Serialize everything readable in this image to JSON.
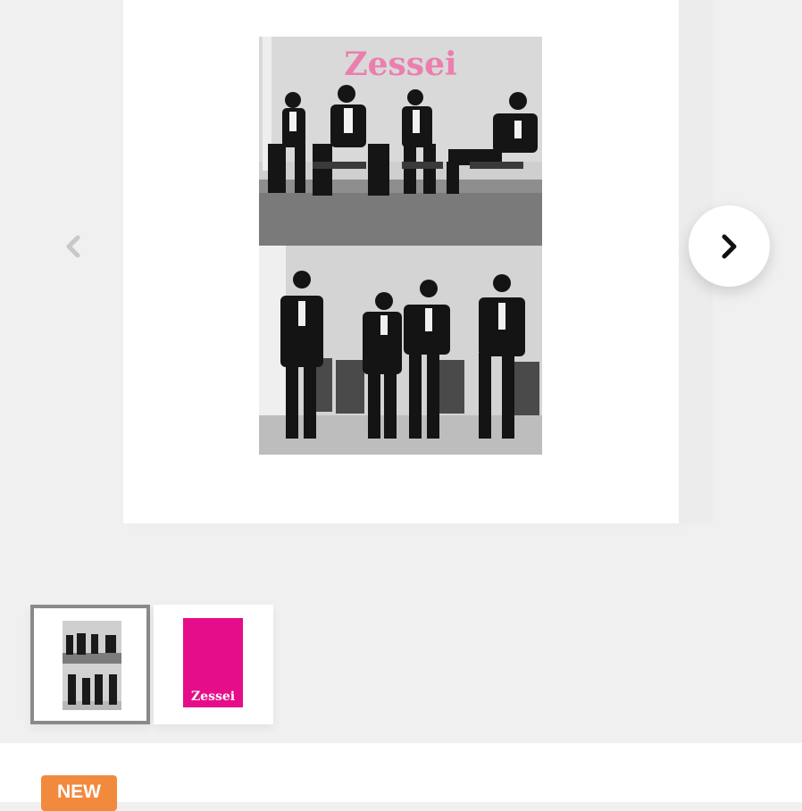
{
  "gallery": {
    "main_image": {
      "logo_text": "Zessei",
      "description": "Black and white photo of four people in suits seated on chairs (top) and standing by chairs (bottom)"
    },
    "prev_icon": "chevron-left-icon",
    "next_icon": "chevron-right-icon",
    "thumbnails": [
      {
        "kind": "bw-photo",
        "active": true
      },
      {
        "kind": "pink-cover",
        "active": false,
        "logo_text": "Zessei"
      }
    ]
  },
  "product": {
    "badge": "NEW"
  },
  "colors": {
    "background": "#f0f0f0",
    "badge": "#f28a3e",
    "cover_pink": "#e60d8a",
    "logo_pink": "#ef6fa8",
    "active_border": "#8a8a8a"
  }
}
